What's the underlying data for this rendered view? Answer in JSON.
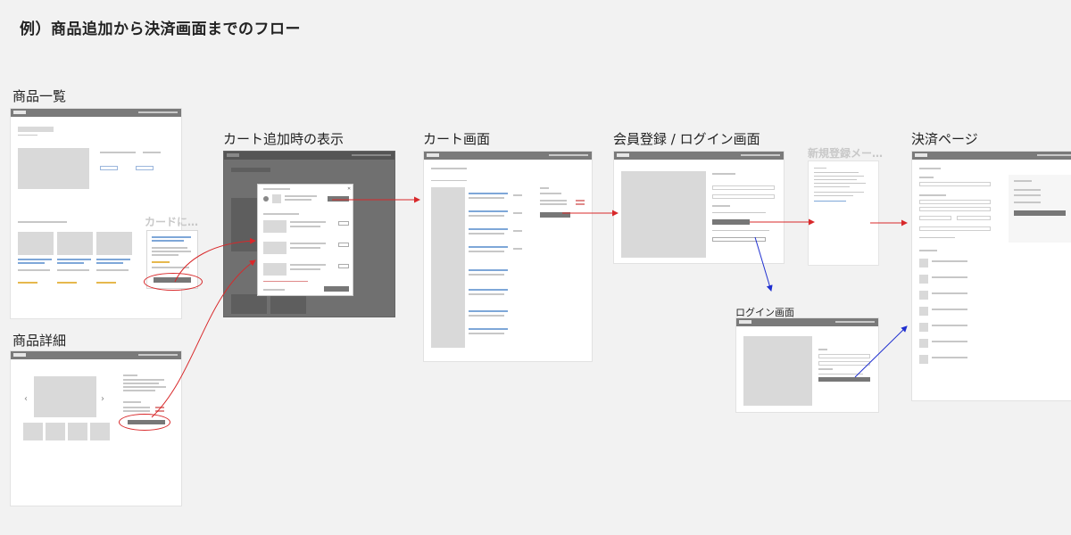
{
  "title": "例）商品追加から決済画面までのフロー",
  "labels": {
    "list": "商品一覧",
    "detail": "商品詳細",
    "cart_add": "カート追加時の表示",
    "cart": "カート画面",
    "member": "会員登録 / ログイン画面",
    "signup_faded": "新規登録メー…",
    "login": "ログイン画面",
    "checkout": "決済ページ",
    "card_faded": "カードに…"
  },
  "colors": {
    "flow_arrow": "#d8282a",
    "branch_arrow": "#1f2fd0",
    "header_bar": "#7a7a7a",
    "placeholder": "#d9d9d9"
  }
}
